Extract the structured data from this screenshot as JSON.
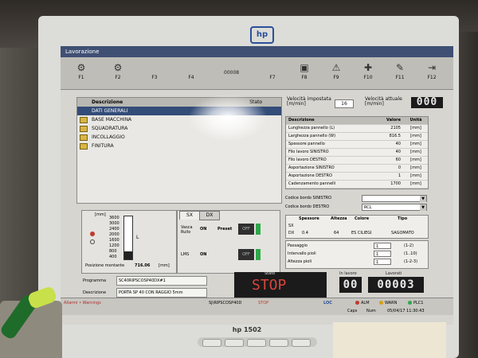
{
  "window": {
    "title": "Lavorazione"
  },
  "fkeys": [
    {
      "label": "F1",
      "icon": "machine-icon"
    },
    {
      "label": "F2",
      "icon": "machine-icon"
    },
    {
      "label": "F3",
      "icon": "blank-icon"
    },
    {
      "label": "F4",
      "icon": "blank-icon"
    },
    {
      "label": "F7",
      "icon": "blank-icon"
    },
    {
      "label": "F8",
      "icon": "picture-icon"
    },
    {
      "label": "F9",
      "icon": "warning-icon"
    },
    {
      "label": "F10",
      "icon": "medic-icon"
    },
    {
      "label": "F11",
      "icon": "tool-icon"
    },
    {
      "label": "F12",
      "icon": "exit-icon"
    }
  ],
  "fbar_code": "00008",
  "tree": {
    "header": {
      "col1": "Descrizione",
      "col2": "Stato"
    },
    "rows": [
      "DATI GENERALI",
      "BASE MACCHINA",
      "SQUADRATURA",
      "INCOLLAGGIO",
      "FINITURA"
    ]
  },
  "velocity": {
    "set_label": "Velocità impostata [m/min]",
    "set_value": "16",
    "actual_label": "Velocità attuale [m/min]",
    "actual_value": "000"
  },
  "params": {
    "headers": [
      "Descrizione",
      "Valore",
      "Unità"
    ],
    "rows": [
      [
        "Lunghezza pannello (L)",
        "2105",
        "[mm]"
      ],
      [
        "Larghezza pannello (W)",
        "816.5",
        "[mm]"
      ],
      [
        "Spessore pannello",
        "40",
        "[mm]"
      ],
      [
        "Filo lavoro SINISTRO",
        "40",
        "[mm]"
      ],
      [
        "Filo lavoro DESTRO",
        "60",
        "[mm]"
      ],
      [
        "Asportazione SINISTRO",
        "0",
        "[mm]"
      ],
      [
        "Asportazione DESTRO",
        "1",
        "[mm]"
      ],
      [
        "Cadenzamento pannelli",
        "1700",
        "[mm]"
      ]
    ]
  },
  "codes": {
    "left_label": "Codice bordo SINISTRO",
    "left_value": "",
    "right_label": "Codice bordo DESTRO",
    "right_value": "RCL"
  },
  "edge": {
    "headers": [
      "Spessore",
      "Altezza",
      "Colore",
      "Tipo"
    ],
    "rows": [
      [
        "SX",
        "",
        "",
        "",
        ""
      ],
      [
        "DX",
        "0.4",
        "64",
        "ES CILIEGI",
        "SAGOMATO"
      ]
    ]
  },
  "passes": [
    {
      "label": "Passaggio",
      "value": "1",
      "range": "(1-2)"
    },
    {
      "label": "Intervallo pioli",
      "value": "1",
      "range": "(1..10)"
    },
    {
      "label": "Altezza pioli",
      "value": "1",
      "range": "(1-2-3)"
    }
  ],
  "gauge": {
    "unit": "[mm]",
    "ticks": [
      "3600",
      "3000",
      "2400",
      "2000",
      "1600",
      "1200",
      "800",
      "400"
    ],
    "position_label": "Posizione montante",
    "position_value": "716.06",
    "position_unit": "[mm]",
    "level": 0.18,
    "side_label": "L"
  },
  "sxdx": {
    "tab_sx": "SX",
    "tab_dx": "DX",
    "row1_label": "Vasca Rullo",
    "row1_state": "ON",
    "preset_label": "Preset",
    "preset_state": "OFF",
    "row2_label": "LMS",
    "row2_state": "ON",
    "row2_off": "OFF"
  },
  "program": {
    "prog_label": "Programma",
    "prog_value": "SC40RIPSCOSP40DX#1",
    "desc_label": "Descrizione",
    "desc_value": "PORTA SP 40 CON RAGGIO 5mm"
  },
  "state": {
    "label": "Stato",
    "value": "STOP"
  },
  "cycle": {
    "label": "In lavoro",
    "value": "00"
  },
  "count": {
    "label": "Lavorati",
    "value": "00003"
  },
  "status_bar": {
    "alarms": "Allarmi • Warnings",
    "program": "SJ\\RIPSCOSP40D",
    "state": "STOP",
    "loc": "LOC",
    "alm": "ALM",
    "warn": "WARN",
    "plc": "PLC1",
    "caps": "Caps",
    "num": "Num",
    "date": "05/04/17 11:30:43"
  },
  "monitor": {
    "brand": "hp",
    "model": "hp 1502"
  },
  "colors": {
    "title_bar": "#3f4f74",
    "selection": "#334c78",
    "stop_red": "#d8453c",
    "on_green": "#2ea84a"
  }
}
